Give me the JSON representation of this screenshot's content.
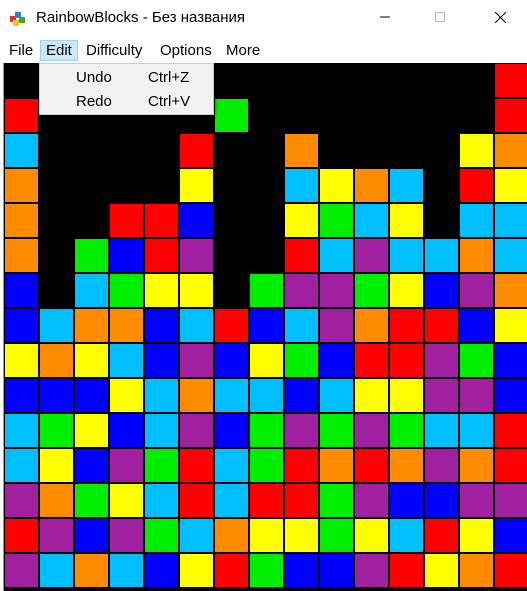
{
  "window": {
    "title": "RainbowBlocks - Без названия",
    "minimize_icon": "minimize-icon",
    "maximize_icon": "maximize-icon",
    "close_icon": "close-icon"
  },
  "menubar": {
    "items": [
      {
        "label": "File"
      },
      {
        "label": "Edit"
      },
      {
        "label": "Difficulty"
      },
      {
        "label": "Options"
      },
      {
        "label": "More"
      }
    ]
  },
  "edit_menu": {
    "items": [
      {
        "label": "Undo",
        "shortcut": "Ctrl+Z"
      },
      {
        "label": "Redo",
        "shortcut": "Ctrl+V"
      }
    ]
  },
  "palette": {
    "R": "#ff0000",
    "G": "#00ee00",
    "B": "#0000ff",
    "Y": "#ffff00",
    "C": "#00bfff",
    "O": "#ff8c00",
    "P": "#a020a0"
  },
  "board": {
    "columns": 15,
    "rows": 15,
    "grid": [
      "..............R",
      "R.....G.......R",
      "C....R..O....YO",
      "O....Y..CYOC.RY",
      "O..RRB..YGCY.CC",
      "O.GBRP..RCPCCOC",
      "B.CGYY.GPPGYBPO",
      "BCOOBCRBCPORRBY",
      "YOYCBPBYGBRRPGB",
      "BBBYCOCCBCYYPPB",
      "CGYBCPBGPGPGCCR",
      "CYBPGRCGROROPOR",
      "POGYCRCRRGPBBPP",
      "RPBPGCOYYGYCRYB",
      "PCOCBYRGBBPRYOR"
    ]
  }
}
